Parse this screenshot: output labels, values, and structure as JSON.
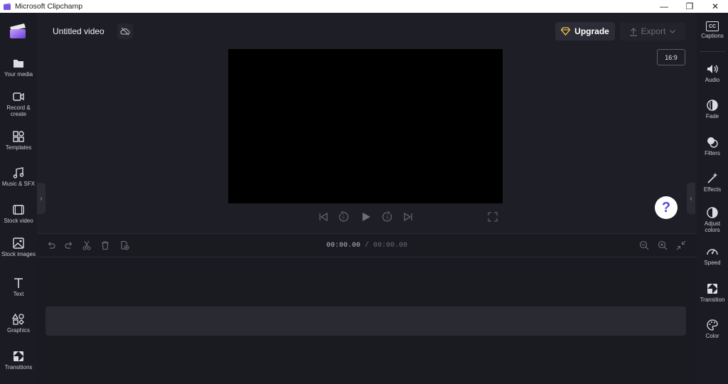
{
  "window": {
    "title": "Microsoft Clipchamp",
    "minimize_glyph": "—",
    "maximize_glyph": "❐",
    "close_glyph": "✕"
  },
  "left_nav": [
    {
      "label": "Your media",
      "icon": "folder-icon"
    },
    {
      "label": "Record & create",
      "icon": "camera-icon"
    },
    {
      "label": "Templates",
      "icon": "templates-icon"
    },
    {
      "label": "Music & SFX",
      "icon": "music-note-icon"
    },
    {
      "label": "Stock video",
      "icon": "film-icon"
    },
    {
      "label": "Stock images",
      "icon": "image-icon"
    },
    {
      "label": "Text",
      "icon": "text-icon"
    },
    {
      "label": "Graphics",
      "icon": "shapes-icon"
    },
    {
      "label": "Transitions",
      "icon": "transition-icon"
    }
  ],
  "right_nav": {
    "captions": {
      "label": "Captions",
      "icon_text": "CC"
    },
    "items": [
      {
        "label": "Audio",
        "icon": "speaker-icon"
      },
      {
        "label": "Fade",
        "icon": "fade-icon"
      },
      {
        "label": "Filters",
        "icon": "filters-icon"
      },
      {
        "label": "Effects",
        "icon": "magic-wand-icon"
      },
      {
        "label": "Adjust colors",
        "icon": "contrast-icon"
      },
      {
        "label": "Speed",
        "icon": "speedometer-icon"
      },
      {
        "label": "Transition",
        "icon": "transition-icon"
      },
      {
        "label": "Color",
        "icon": "palette-icon"
      }
    ]
  },
  "editor": {
    "project_title": "Untitled video",
    "upgrade_label": "Upgrade",
    "export_label": "Export",
    "aspect_ratio": "16:9",
    "help_glyph": "?"
  },
  "timeline": {
    "current_time": "00:00.00",
    "separator": " / ",
    "total_time": "00:00.00"
  },
  "colors": {
    "background": "#1e1e26",
    "sidebar": "#1b1b23",
    "accent": "#5a4ad6",
    "upgrade_gem": "#f5c542"
  }
}
